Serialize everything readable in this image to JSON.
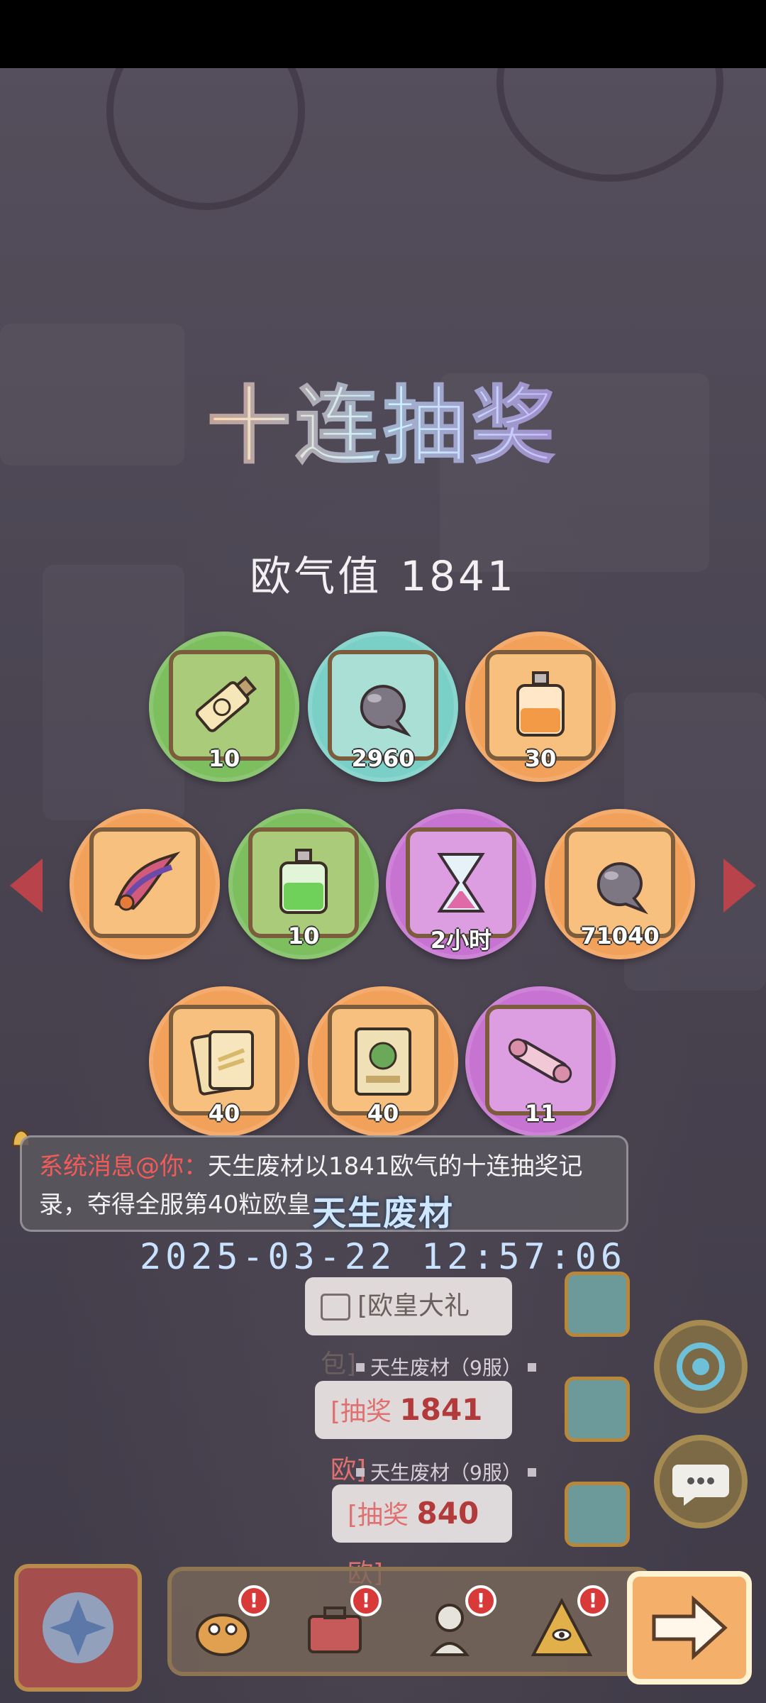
{
  "title": "十连抽奖",
  "luck": {
    "label": "欧气值",
    "value": "1841"
  },
  "rewards": [
    {
      "name": "tube",
      "qty": "10",
      "color": "green"
    },
    {
      "name": "spirit-blob",
      "qty": "2960",
      "color": "teal"
    },
    {
      "name": "orange-potion",
      "qty": "30",
      "color": "orange"
    },
    {
      "name": "feather-plume",
      "qty": "",
      "color": "orange"
    },
    {
      "name": "green-potion",
      "qty": "10",
      "color": "green"
    },
    {
      "name": "hourglass",
      "qty": "2小时",
      "color": "purple"
    },
    {
      "name": "spirit-blob",
      "qty": "71040",
      "color": "orange"
    },
    {
      "name": "scroll-cards",
      "qty": "40",
      "color": "orange"
    },
    {
      "name": "certificate",
      "qty": "40",
      "color": "orange"
    },
    {
      "name": "bone-tube",
      "qty": "11",
      "color": "purple"
    }
  ],
  "system_message": {
    "prefix": "系统消息@你：",
    "line1": "天生废材以1841欧气的十连抽奖记",
    "line2": "录，夺得全服第40粒欧皇"
  },
  "winner_name": "天生废材",
  "datetime": "2025-03-22 12:57:06",
  "chat": [
    {
      "bubble": "[欧皇大礼包]"
    },
    {
      "name": "天生废材（9服）",
      "prefix": "[抽奖 ",
      "num": "1841",
      "suffix": " 欧]"
    },
    {
      "name": "天生废材（9服）",
      "prefix": "[抽奖 ",
      "num": "840",
      "suffix": " 欧]"
    }
  ],
  "icons": {
    "left": "arrow-left-icon",
    "right": "arrow-right-icon",
    "badge": "!"
  }
}
